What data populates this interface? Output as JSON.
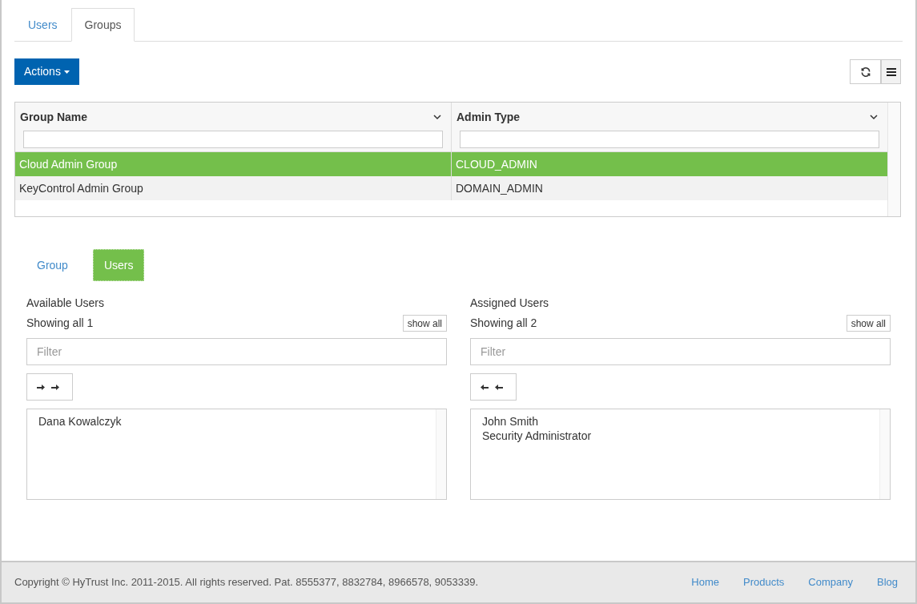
{
  "tabs": [
    {
      "label": "Users",
      "selected": false
    },
    {
      "label": "Groups",
      "selected": true
    }
  ],
  "actions_button": "Actions",
  "table": {
    "columns": [
      "Group Name",
      "Admin Type"
    ],
    "rows": [
      {
        "cells": [
          "Cloud Admin Group",
          "CLOUD_ADMIN"
        ],
        "selected": true
      },
      {
        "cells": [
          "KeyControl Admin Group",
          "DOMAIN_ADMIN"
        ],
        "selected": false
      }
    ]
  },
  "sub_tabs": [
    {
      "label": "Group",
      "selected": false
    },
    {
      "label": "Users",
      "selected": true
    }
  ],
  "lists": [
    {
      "kind": "available",
      "title": "Available Users",
      "count": "Showing all 1",
      "show_all": "show all",
      "placeholder": "Filter",
      "items": [
        "Dana Kowalczyk"
      ]
    },
    {
      "kind": "assigned",
      "title": "Assigned Users",
      "count": "Showing all 2",
      "show_all": "show all",
      "placeholder": "Filter",
      "items": [
        "John Smith",
        "Security Administrator"
      ]
    }
  ],
  "footer": {
    "copyright": "Copyright © HyTrust Inc. 2011-2015. All rights reserved. Pat. 8555377, 8832784, 8966578, 9053339.",
    "links": [
      "Home",
      "Products",
      "Company",
      "Blog"
    ]
  }
}
